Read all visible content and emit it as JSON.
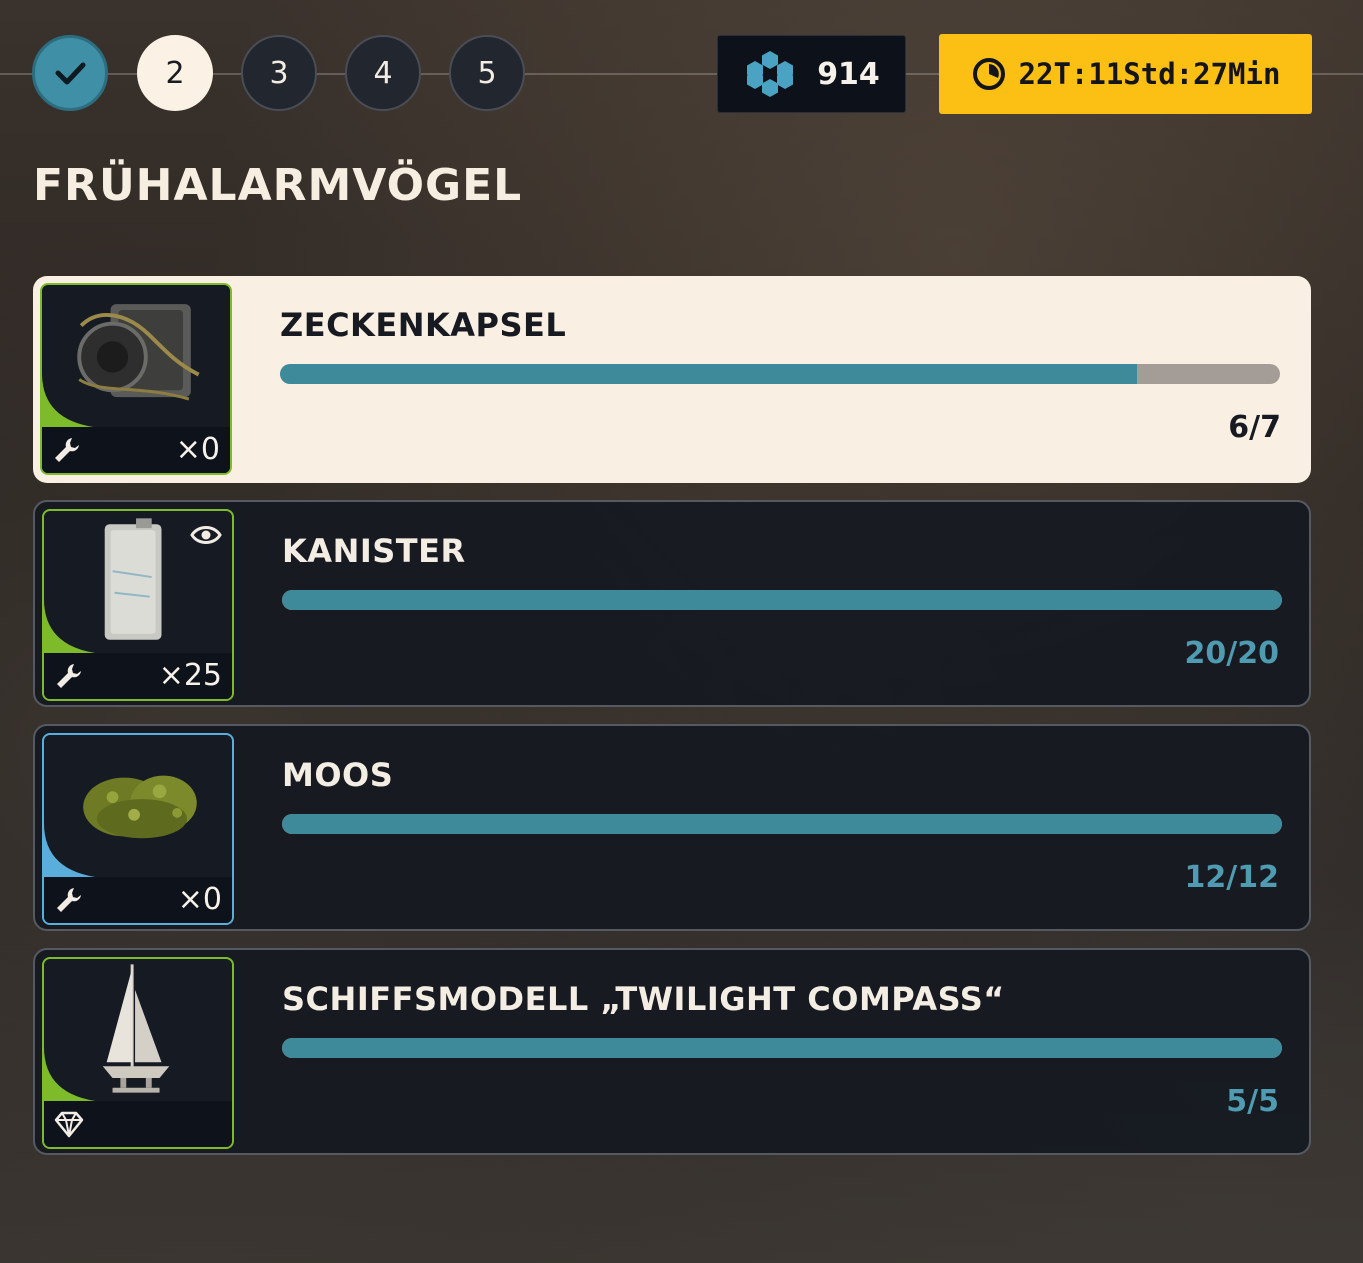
{
  "steps": [
    {
      "label": "",
      "state": "done",
      "icon": "check-icon"
    },
    {
      "label": "2",
      "state": "current"
    },
    {
      "label": "3",
      "state": "todo"
    },
    {
      "label": "4",
      "state": "todo"
    },
    {
      "label": "5",
      "state": "todo"
    }
  ],
  "currency": {
    "value": "914",
    "icon": "hexagon-cluster-icon",
    "color": "#4aa3c2"
  },
  "timer": {
    "text": "22T:11Std:27Min",
    "icon": "clock-icon",
    "color": "#fcbf14"
  },
  "title": "FRÜHALARMVÖGEL",
  "items": [
    {
      "name": "ZECKENKAPSEL",
      "progress": "6/7",
      "fraction": 0.857,
      "count": "×0",
      "badge": "wrench-icon",
      "rarity_color": "#7dbb2a",
      "active": true
    },
    {
      "name": "KANISTER",
      "progress": "20/20",
      "fraction": 1.0,
      "count": "×25",
      "badge": "wrench-icon",
      "rarity_color": "#7dbb2a",
      "tracked": true
    },
    {
      "name": "MOOS",
      "progress": "12/12",
      "fraction": 1.0,
      "count": "×0",
      "badge": "wrench-icon",
      "rarity_color": "#5aaedc"
    },
    {
      "name": "SCHIFFSMODELL „TWILIGHT COMPASS“",
      "progress": "5/5",
      "fraction": 1.0,
      "count": "",
      "badge": "diamond-icon",
      "rarity_color": "#7dbb2a"
    }
  ]
}
